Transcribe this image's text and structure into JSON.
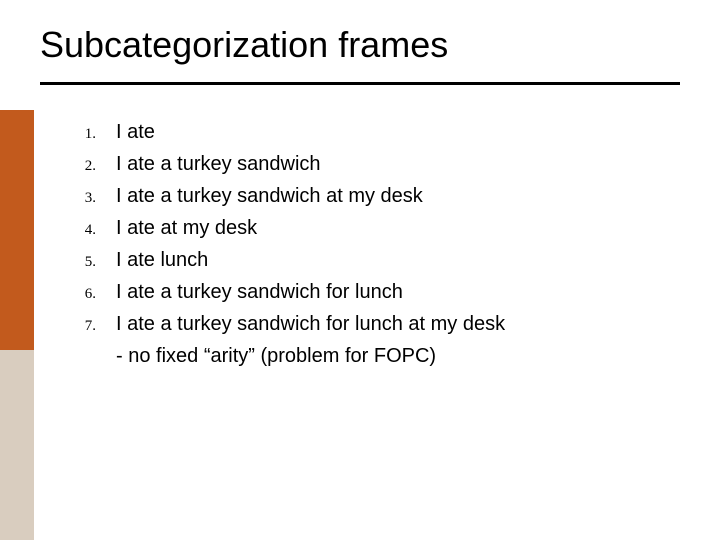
{
  "title": "Subcategorization frames",
  "items": [
    {
      "n": "1.",
      "text": "I ate"
    },
    {
      "n": "2.",
      "text": "I ate a turkey sandwich"
    },
    {
      "n": "3.",
      "text": "I ate a turkey sandwich at my desk"
    },
    {
      "n": "4.",
      "text": "I ate at my desk"
    },
    {
      "n": "5.",
      "text": "I ate lunch"
    },
    {
      "n": "6.",
      "text": "I ate a turkey sandwich for lunch"
    },
    {
      "n": "7.",
      "text": "I ate a turkey sandwich for lunch at my desk"
    }
  ],
  "footnote": "- no fixed “arity” (problem for FOPC)",
  "colors": {
    "accent_orange": "#c25a1d",
    "accent_tan": "#d9cdbf"
  }
}
